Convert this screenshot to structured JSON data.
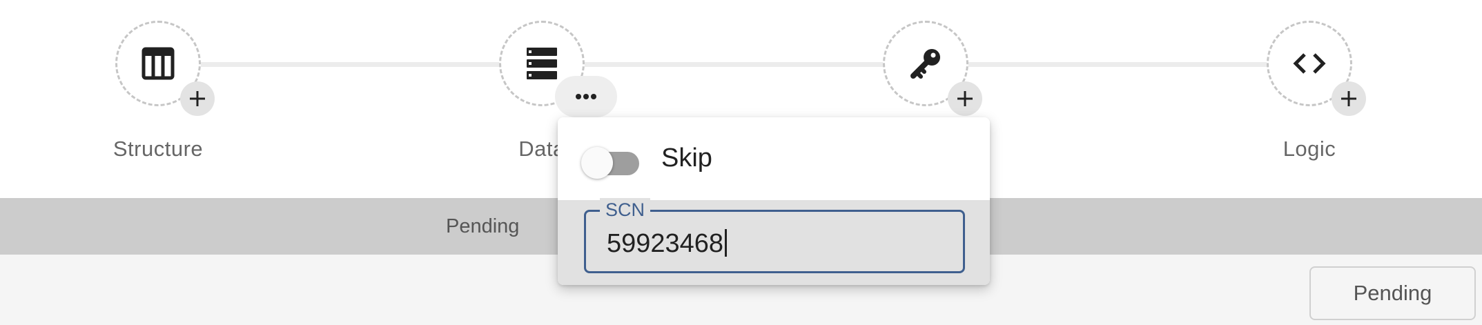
{
  "steps": [
    {
      "label": "Structure",
      "icon": "table-icon"
    },
    {
      "label": "Data",
      "icon": "rows-icon"
    },
    {
      "label": "",
      "icon": "key-icon"
    },
    {
      "label": "Logic",
      "icon": "code-icon"
    }
  ],
  "status_bar": {
    "text": "Pending"
  },
  "footer": {
    "pending_label": "Pending"
  },
  "popover": {
    "skip_label": "Skip",
    "skip_enabled": false,
    "scn_label": "SCN",
    "scn_value": "59923468"
  },
  "colors": {
    "accent": "#3f5f8e",
    "status_bar_bg": "#cccccc",
    "footer_bg": "#f5f5f5"
  }
}
